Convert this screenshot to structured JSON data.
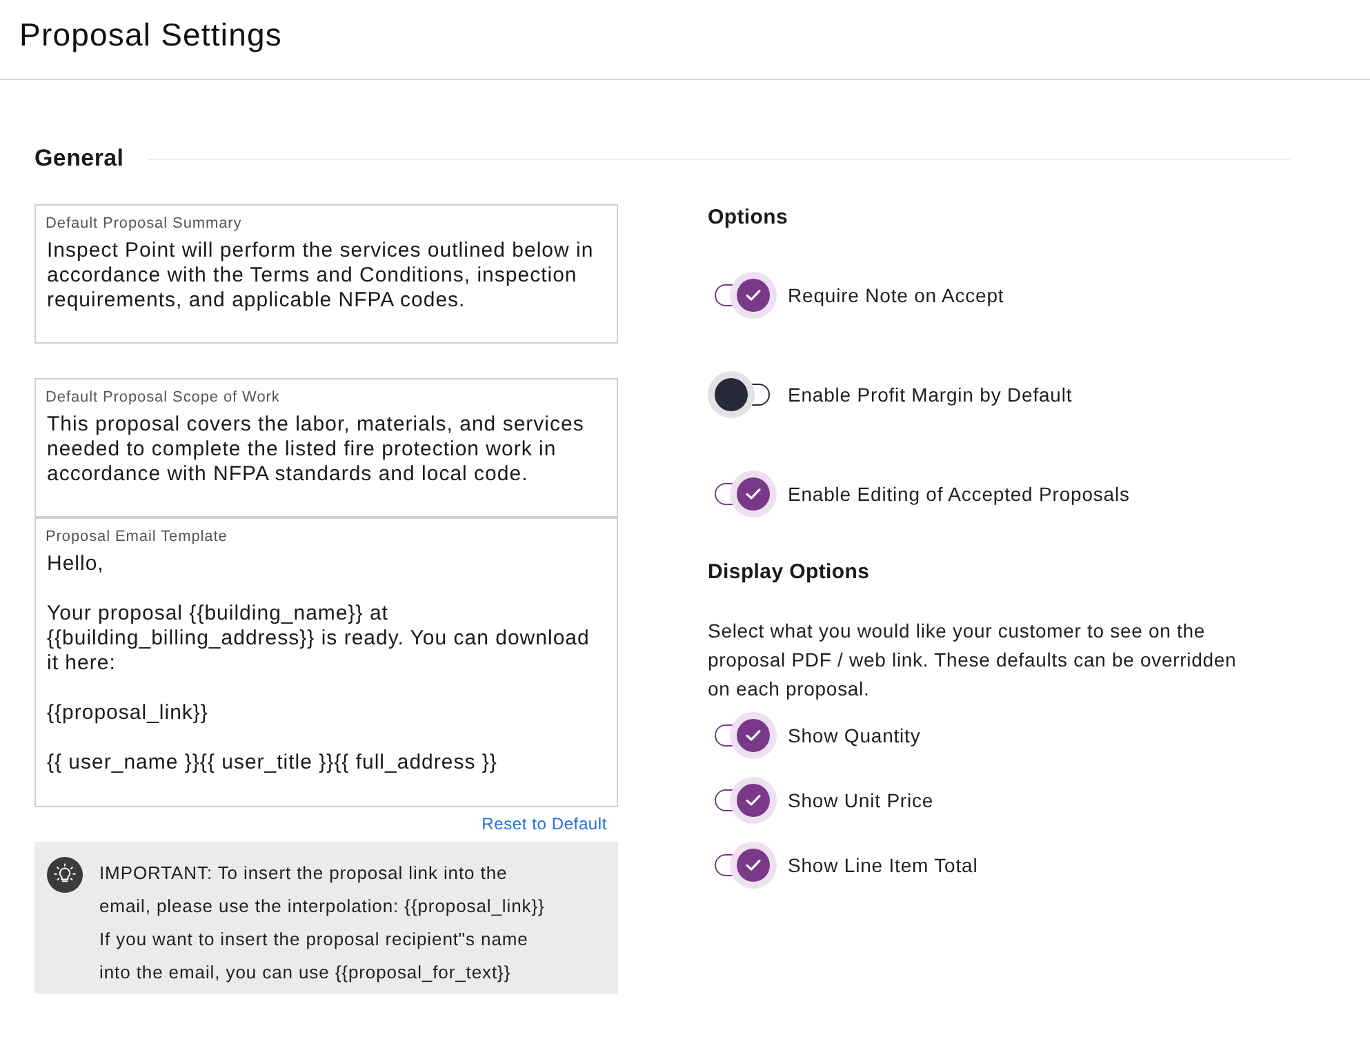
{
  "page": {
    "title": "Proposal Settings"
  },
  "general": {
    "heading": "General",
    "fields": [
      {
        "label": "Default Proposal Summary",
        "value": "Inspect Point will perform the services outlined below in accordance with the Terms and Conditions, inspection requirements, and applicable NFPA codes."
      },
      {
        "label": "Default Proposal Scope of Work",
        "value": "This proposal covers the labor, materials, and services needed to complete the listed fire protection work in accordance with NFPA standards and local code."
      },
      {
        "label": "Proposal Email Template",
        "value": "Hello,\n\nYour proposal {{building_name}} at {{building_billing_address}} is ready. You can download it here:\n\n{{proposal_link}}\n\n{{ user_name }}{{ user_title }}{{ full_address }}"
      }
    ],
    "reset_link": "Reset to Default",
    "notice": [
      "IMPORTANT: To insert the proposal link into the email, please use the interpolation: {{proposal_link}}",
      "If you want to insert the proposal recipient\"s name into the email, you can use {{proposal_for_text}}"
    ]
  },
  "options": {
    "heading": "Options",
    "toggles": [
      {
        "label": "Require Note on Accept",
        "on": true
      },
      {
        "label": "Enable Profit Margin by Default",
        "on": false
      },
      {
        "label": "Enable Editing of Accepted Proposals",
        "on": true
      }
    ]
  },
  "display_options": {
    "heading": "Display Options",
    "description": "Select what you would like your customer to see on the proposal PDF / web link. These defaults can be overridden on each proposal.",
    "toggles": [
      {
        "label": "Show Quantity",
        "on": true
      },
      {
        "label": "Show Unit Price",
        "on": true
      },
      {
        "label": "Show Line Item Total",
        "on": true
      }
    ]
  }
}
